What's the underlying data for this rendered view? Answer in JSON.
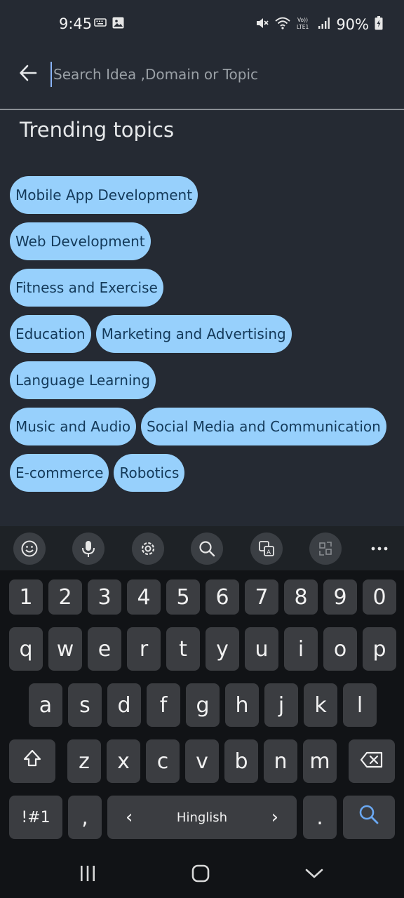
{
  "status_bar": {
    "time": "9:45",
    "battery_percent": "90%",
    "icons": [
      "keyboard-icon",
      "image-icon",
      "mute-icon",
      "wifi-icon",
      "volte-icon",
      "signal-icon",
      "battery-charging-icon"
    ],
    "volte_label": "Vo)) LTE1"
  },
  "search": {
    "placeholder": "Search Idea ,Domain or Topic",
    "value": ""
  },
  "section_title": "Trending topics",
  "topics": [
    "Mobile App Development",
    "Web Development",
    "Fitness and Exercise",
    "Education",
    "Marketing and Advertising",
    "Language Learning",
    "Music and Audio",
    "Social Media and Communication",
    "E-commerce",
    "Robotics"
  ],
  "keyboard": {
    "toolbar_icons": [
      "emoji-icon",
      "mic-icon",
      "settings-icon",
      "search-icon",
      "translate-icon",
      "convert-icon",
      "more-icon"
    ],
    "row_numbers": [
      "1",
      "2",
      "3",
      "4",
      "5",
      "6",
      "7",
      "8",
      "9",
      "0"
    ],
    "row_1": [
      "q",
      "w",
      "e",
      "r",
      "t",
      "y",
      "u",
      "i",
      "o",
      "p"
    ],
    "row_2": [
      "a",
      "s",
      "d",
      "f",
      "g",
      "h",
      "j",
      "k",
      "l"
    ],
    "row_3": [
      "z",
      "x",
      "c",
      "v",
      "b",
      "n",
      "m"
    ],
    "symbols_label": "!#1",
    "comma_label": ",",
    "language_label": "Hinglish",
    "period_label": ".",
    "left_arrow": "‹",
    "right_arrow": "›"
  },
  "nav_bar": {
    "icons": [
      "recents-icon",
      "home-icon",
      "back-down-icon"
    ]
  },
  "colors": {
    "background": "#252a33",
    "chip": "#97d0fc",
    "chip_text": "#143a5a",
    "keyboard": "#111316",
    "key": "#3b3d41",
    "accent": "#8ab4f8"
  }
}
